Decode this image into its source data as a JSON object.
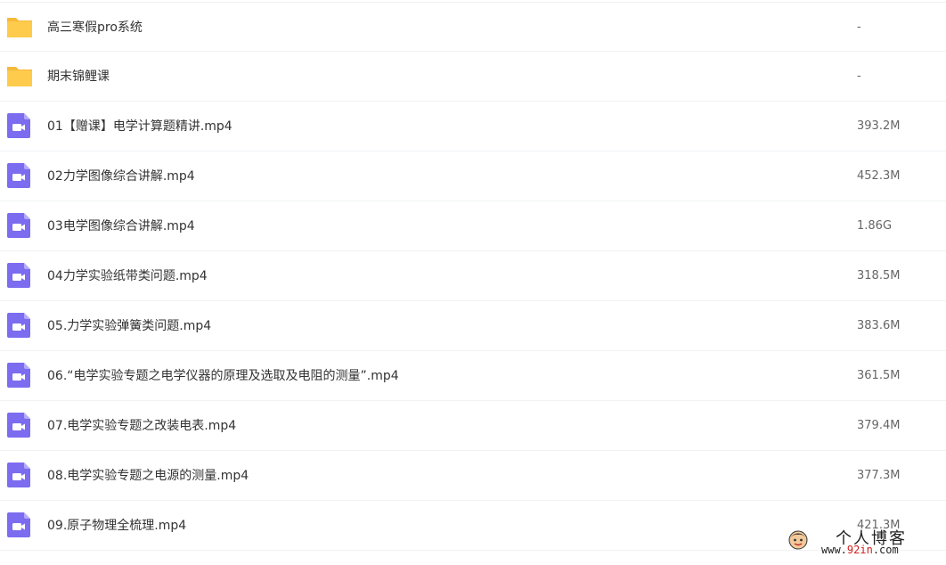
{
  "files": [
    {
      "type": "folder",
      "name": "高三寒假pro系统",
      "size": "-"
    },
    {
      "type": "folder",
      "name": "期末锦鲤课",
      "size": "-"
    },
    {
      "type": "video",
      "name": "01【赠课】电学计算题精讲.mp4",
      "size": "393.2M"
    },
    {
      "type": "video",
      "name": "02力学图像综合讲解.mp4",
      "size": "452.3M"
    },
    {
      "type": "video",
      "name": "03电学图像综合讲解.mp4",
      "size": "1.86G"
    },
    {
      "type": "video",
      "name": "04力学实验纸带类问题.mp4",
      "size": "318.5M"
    },
    {
      "type": "video",
      "name": "05.力学实验弹簧类问题.mp4",
      "size": "383.6M"
    },
    {
      "type": "video",
      "name": "06.“电学实验专题之电学仪器的原理及选取及电阻的测量”.mp4",
      "size": "361.5M"
    },
    {
      "type": "video",
      "name": "07.电学实验专题之改装电表.mp4",
      "size": "379.4M"
    },
    {
      "type": "video",
      "name": "08.电学实验专题之电源的测量.mp4",
      "size": "377.3M"
    },
    {
      "type": "video",
      "name": "09.原子物理全梳理.mp4",
      "size": "421.3M"
    }
  ],
  "watermark": {
    "title": "个人博客",
    "url_prefix": "www.",
    "url_accent": "92in",
    "url_suffix": ".com"
  },
  "colors": {
    "folder": "#ffcb4c",
    "folder_tab": "#f6b93b",
    "video": "#7b6cf0",
    "video_light": "#b3a9ff"
  }
}
